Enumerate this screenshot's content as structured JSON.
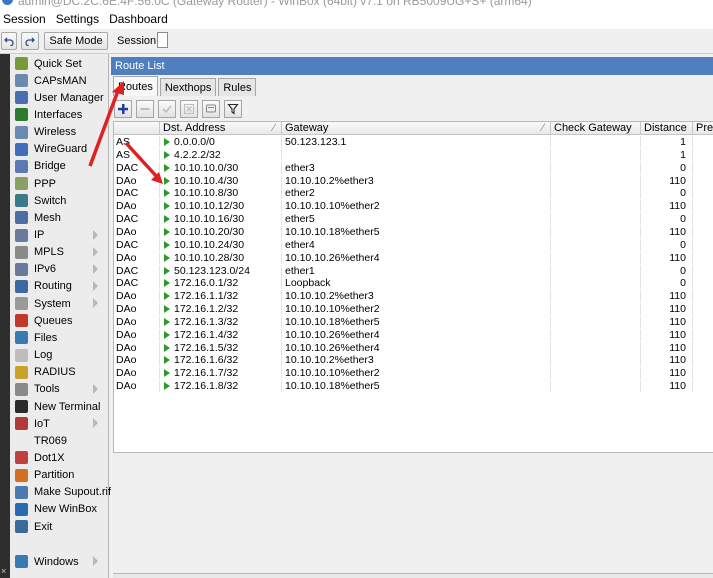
{
  "window": {
    "title": "admin@DC:2C:6E:4F:56:0C (Gateway Router) - WinBox (64bit) v7.1 on RB5009UG+S+ (arm64)"
  },
  "menu": [
    "Session",
    "Settings",
    "Dashboard"
  ],
  "toolbar": {
    "safe_mode_label": "Safe Mode",
    "session_label": "Session:"
  },
  "sidebar": {
    "items": [
      {
        "label": "Quick Set",
        "icon": "wand-icon",
        "color": "#7a9a3a"
      },
      {
        "label": "CAPsMAN",
        "icon": "antenna-icon",
        "color": "#6a8ab0"
      },
      {
        "label": "User Manager",
        "icon": "users-icon",
        "color": "#4a6fb0"
      },
      {
        "label": "Interfaces",
        "icon": "interfaces-icon",
        "color": "#2e7a2e"
      },
      {
        "label": "Wireless",
        "icon": "wireless-icon",
        "color": "#6a8ab0"
      },
      {
        "label": "WireGuard",
        "icon": "wireguard-icon",
        "color": "#3f6fb8"
      },
      {
        "label": "Bridge",
        "icon": "bridge-icon",
        "color": "#5a7ab0"
      },
      {
        "label": "PPP",
        "icon": "ppp-icon",
        "color": "#8aa060"
      },
      {
        "label": "Switch",
        "icon": "switch-icon",
        "color": "#3a7a8a"
      },
      {
        "label": "Mesh",
        "icon": "mesh-icon",
        "color": "#4a6fa0"
      },
      {
        "label": "IP",
        "icon": "ip-icon",
        "color": "#6a7a9a",
        "sub": true
      },
      {
        "label": "MPLS",
        "icon": "mpls-icon",
        "color": "#8a8a8a",
        "sub": true
      },
      {
        "label": "IPv6",
        "icon": "ipv6-icon",
        "color": "#6a7a9a",
        "sub": true
      },
      {
        "label": "Routing",
        "icon": "routing-icon",
        "color": "#3a6aa0",
        "sub": true
      },
      {
        "label": "System",
        "icon": "gear-icon",
        "color": "#9a9a9a",
        "sub": true
      },
      {
        "label": "Queues",
        "icon": "queues-icon",
        "color": "#c03a2a"
      },
      {
        "label": "Files",
        "icon": "folder-icon",
        "color": "#3a7ab0"
      },
      {
        "label": "Log",
        "icon": "log-icon",
        "color": "#bdbdbd"
      },
      {
        "label": "RADIUS",
        "icon": "radius-icon",
        "color": "#c8a22a"
      },
      {
        "label": "Tools",
        "icon": "tools-icon",
        "color": "#8a8a8a",
        "sub": true
      },
      {
        "label": "New Terminal",
        "icon": "terminal-icon",
        "color": "#2a2a2a"
      },
      {
        "label": "IoT",
        "icon": "iot-icon",
        "color": "#b03a3a",
        "sub": true
      },
      {
        "label": "TR069",
        "icon": "",
        "color": ""
      },
      {
        "label": "Dot1X",
        "icon": "dot1x-icon",
        "color": "#c04040"
      },
      {
        "label": "Partition",
        "icon": "partition-icon",
        "color": "#d07020"
      },
      {
        "label": "Make Supout.rif",
        "icon": "supout-icon",
        "color": "#4a7ab0"
      },
      {
        "label": "New WinBox",
        "icon": "winbox-icon",
        "color": "#2a6ab0"
      },
      {
        "label": "Exit",
        "icon": "exit-icon",
        "color": "#3a6a9a"
      }
    ],
    "windows": {
      "label": "Windows",
      "icon": "windows-icon",
      "color": "#3a7ab0"
    }
  },
  "panel": {
    "title": "Route List",
    "tabs": [
      {
        "label": "Routes",
        "active": true
      },
      {
        "label": "Nexthops",
        "active": false
      },
      {
        "label": "Rules",
        "active": false
      }
    ],
    "columns": [
      "",
      "Dst. Address",
      "Gateway",
      "Check Gateway",
      "Distance",
      "Pref"
    ],
    "rows": [
      {
        "flag": "AS",
        "dst": "0.0.0.0/0",
        "gw": "50.123.123.1",
        "dist": "1"
      },
      {
        "flag": "AS",
        "dst": "4.2.2.2/32",
        "gw": "",
        "dist": "1"
      },
      {
        "flag": "DAC",
        "dst": "10.10.10.0/30",
        "gw": "ether3",
        "dist": "0"
      },
      {
        "flag": "DAo",
        "dst": "10.10.10.4/30",
        "gw": "10.10.10.2%ether3",
        "dist": "110"
      },
      {
        "flag": "DAC",
        "dst": "10.10.10.8/30",
        "gw": "ether2",
        "dist": "0"
      },
      {
        "flag": "DAo",
        "dst": "10.10.10.12/30",
        "gw": "10.10.10.10%ether2",
        "dist": "110"
      },
      {
        "flag": "DAC",
        "dst": "10.10.10.16/30",
        "gw": "ether5",
        "dist": "0"
      },
      {
        "flag": "DAo",
        "dst": "10.10.10.20/30",
        "gw": "10.10.10.18%ether5",
        "dist": "110"
      },
      {
        "flag": "DAC",
        "dst": "10.10.10.24/30",
        "gw": "ether4",
        "dist": "0"
      },
      {
        "flag": "DAo",
        "dst": "10.10.10.28/30",
        "gw": "10.10.10.26%ether4",
        "dist": "110"
      },
      {
        "flag": "DAC",
        "dst": "50.123.123.0/24",
        "gw": "ether1",
        "dist": "0"
      },
      {
        "flag": "DAC",
        "dst": "172.16.0.1/32",
        "gw": "Loopback",
        "dist": "0"
      },
      {
        "flag": "DAo",
        "dst": "172.16.1.1/32",
        "gw": "10.10.10.2%ether3",
        "dist": "110"
      },
      {
        "flag": "DAo",
        "dst": "172.16.1.2/32",
        "gw": "10.10.10.10%ether2",
        "dist": "110"
      },
      {
        "flag": "DAo",
        "dst": "172.16.1.3/32",
        "gw": "10.10.10.18%ether5",
        "dist": "110"
      },
      {
        "flag": "DAo",
        "dst": "172.16.1.4/32",
        "gw": "10.10.10.26%ether4",
        "dist": "110"
      },
      {
        "flag": "DAo",
        "dst": "172.16.1.5/32",
        "gw": "10.10.10.26%ether4",
        "dist": "110"
      },
      {
        "flag": "DAo",
        "dst": "172.16.1.6/32",
        "gw": "10.10.10.2%ether3",
        "dist": "110"
      },
      {
        "flag": "DAo",
        "dst": "172.16.1.7/32",
        "gw": "10.10.10.10%ether2",
        "dist": "110"
      },
      {
        "flag": "DAo",
        "dst": "172.16.1.8/32",
        "gw": "10.10.10.18%ether5",
        "dist": "110"
      }
    ]
  },
  "annotation_color": "#e02020"
}
